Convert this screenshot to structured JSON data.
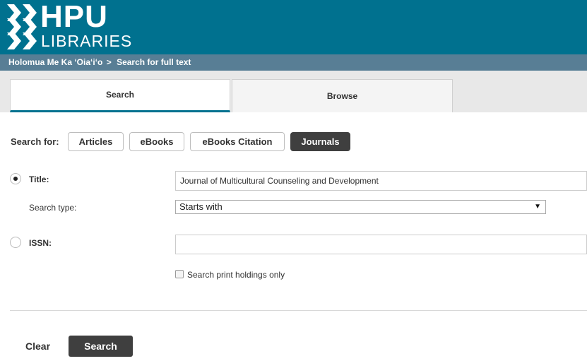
{
  "header": {
    "logo_main": "HPU",
    "logo_sub": "LIBRARIES",
    "background": "#00718f"
  },
  "breadcrumb": {
    "items": [
      "Holomua Me Ka ‘Oia‘i‘o",
      "Search for full text"
    ],
    "separator": ">"
  },
  "tabs": [
    {
      "label": "Search",
      "active": true
    },
    {
      "label": "Browse",
      "active": false
    }
  ],
  "search_for": {
    "label": "Search for:",
    "options": [
      "Articles",
      "eBooks",
      "eBooks Citation",
      "Journals"
    ],
    "selected": "Journals"
  },
  "form": {
    "title_label": "Title:",
    "title_value": "Journal of Multicultural Counseling and Development",
    "title_checked": true,
    "search_type_label": "Search type:",
    "search_type_value": "Starts with",
    "issn_label": "ISSN:",
    "issn_value": "",
    "issn_checked": false,
    "print_only_label": "Search print holdings only",
    "print_only_checked": false
  },
  "actions": {
    "clear_label": "Clear",
    "search_label": "Search"
  },
  "colors": {
    "brand": "#00718f",
    "breadcrumb_bar": "#587e95",
    "active_button": "#3f3f3f"
  }
}
